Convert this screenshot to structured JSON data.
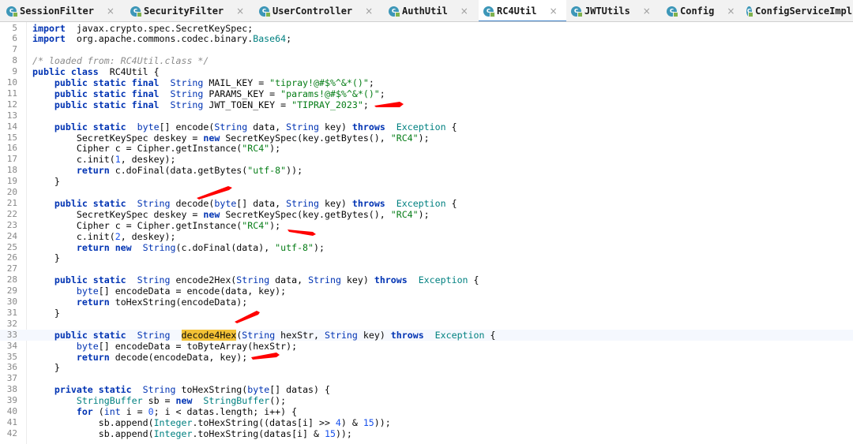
{
  "tabs": [
    {
      "label": "SessionFilter",
      "active": false
    },
    {
      "label": "SecurityFilter",
      "active": false
    },
    {
      "label": "UserController",
      "active": false
    },
    {
      "label": "AuthUtil",
      "active": false
    },
    {
      "label": "RC4Util",
      "active": true
    },
    {
      "label": "JWTUtils",
      "active": false
    },
    {
      "label": "Config",
      "active": false
    },
    {
      "label": "ConfigServiceImpl",
      "active": false
    }
  ],
  "tab_icon_glyph": "c",
  "tab_close_glyph": "×",
  "line_numbers": [
    "5",
    "6",
    "7",
    "8",
    "9",
    "10",
    "11",
    "12",
    "13",
    "14",
    "15",
    "16",
    "17",
    "18",
    "19",
    "20",
    "21",
    "22",
    "23",
    "24",
    "25",
    "26",
    "27",
    "28",
    "29",
    "30",
    "31",
    "32",
    "33",
    "34",
    "35",
    "36",
    "37",
    "38",
    "39",
    "40",
    "41",
    "42"
  ],
  "code_lines": [
    [
      [
        "kw",
        "import"
      ],
      [
        "",
        "  javax.crypto.spec.SecretKeySpec;"
      ]
    ],
    [
      [
        "kw",
        "import"
      ],
      [
        "",
        "  org.apache.commons.codec.binary."
      ],
      [
        "lib",
        "Base64"
      ],
      [
        "",
        ";"
      ]
    ],
    [],
    [
      [
        "cm",
        "/* loaded from: RC4Util.class */"
      ]
    ],
    [
      [
        "kw",
        "public class"
      ],
      [
        "",
        "  RC4Util {"
      ]
    ],
    [
      [
        "",
        "    "
      ],
      [
        "kw",
        "public static final"
      ],
      [
        "",
        "  "
      ],
      [
        "ty",
        "String"
      ],
      [
        "",
        " MAIL_KEY = "
      ],
      [
        "str",
        "\"tipray!@#$%^&*()\""
      ],
      [
        "",
        ";"
      ]
    ],
    [
      [
        "",
        "    "
      ],
      [
        "kw",
        "public static final"
      ],
      [
        "",
        "  "
      ],
      [
        "ty",
        "String"
      ],
      [
        "",
        " PARAMS_KEY = "
      ],
      [
        "str",
        "\"params!@#$%^&*()\""
      ],
      [
        "",
        ";"
      ]
    ],
    [
      [
        "",
        "    "
      ],
      [
        "kw",
        "public static final"
      ],
      [
        "",
        "  "
      ],
      [
        "ty",
        "String"
      ],
      [
        "",
        " JWT_TOEN_KEY = "
      ],
      [
        "str",
        "\"TIPRAY_2023\""
      ],
      [
        "",
        ";"
      ]
    ],
    [],
    [
      [
        "",
        "    "
      ],
      [
        "kw",
        "public static"
      ],
      [
        "",
        "  "
      ],
      [
        "ty",
        "byte"
      ],
      [
        "",
        "[] encode("
      ],
      [
        "ty",
        "String"
      ],
      [
        "",
        " data, "
      ],
      [
        "ty",
        "String"
      ],
      [
        "",
        " key) "
      ],
      [
        "kw",
        "throws"
      ],
      [
        "",
        "  "
      ],
      [
        "lib",
        "Exception"
      ],
      [
        "",
        " {"
      ]
    ],
    [
      [
        "",
        "        SecretKeySpec deskey = "
      ],
      [
        "kw",
        "new"
      ],
      [
        "",
        " SecretKeySpec(key.getBytes(), "
      ],
      [
        "str",
        "\"RC4\""
      ],
      [
        "",
        ");"
      ]
    ],
    [
      [
        "",
        "        Cipher c = Cipher.getInstance("
      ],
      [
        "str",
        "\"RC4\""
      ],
      [
        "",
        ");"
      ]
    ],
    [
      [
        "",
        "        c.init("
      ],
      [
        "num",
        "1"
      ],
      [
        "",
        ", deskey);"
      ]
    ],
    [
      [
        "",
        "        "
      ],
      [
        "kw",
        "return"
      ],
      [
        "",
        " c.doFinal(data.getBytes("
      ],
      [
        "str",
        "\"utf-8\""
      ],
      [
        "",
        "));"
      ]
    ],
    [
      [
        "",
        "    }"
      ]
    ],
    [],
    [
      [
        "",
        "    "
      ],
      [
        "kw",
        "public static"
      ],
      [
        "",
        "  "
      ],
      [
        "ty",
        "String"
      ],
      [
        "",
        " decode("
      ],
      [
        "ty",
        "byte"
      ],
      [
        "",
        "[] data, "
      ],
      [
        "ty",
        "String"
      ],
      [
        "",
        " key) "
      ],
      [
        "kw",
        "throws"
      ],
      [
        "",
        "  "
      ],
      [
        "lib",
        "Exception"
      ],
      [
        "",
        " {"
      ]
    ],
    [
      [
        "",
        "        SecretKeySpec deskey = "
      ],
      [
        "kw",
        "new"
      ],
      [
        "",
        " SecretKeySpec(key.getBytes(), "
      ],
      [
        "str",
        "\"RC4\""
      ],
      [
        "",
        ");"
      ]
    ],
    [
      [
        "",
        "        Cipher c = Cipher.getInstance("
      ],
      [
        "str",
        "\"RC4\""
      ],
      [
        "",
        ");"
      ]
    ],
    [
      [
        "",
        "        c.init("
      ],
      [
        "num",
        "2"
      ],
      [
        "",
        ", deskey);"
      ]
    ],
    [
      [
        "",
        "        "
      ],
      [
        "kw",
        "return new"
      ],
      [
        "",
        "  "
      ],
      [
        "ty",
        "String"
      ],
      [
        "",
        "(c.doFinal(data), "
      ],
      [
        "str",
        "\"utf-8\""
      ],
      [
        "",
        ");"
      ]
    ],
    [
      [
        "",
        "    }"
      ]
    ],
    [],
    [
      [
        "",
        "    "
      ],
      [
        "kw",
        "public static"
      ],
      [
        "",
        "  "
      ],
      [
        "ty",
        "String"
      ],
      [
        "",
        " encode2Hex("
      ],
      [
        "ty",
        "String"
      ],
      [
        "",
        " data, "
      ],
      [
        "ty",
        "String"
      ],
      [
        "",
        " key) "
      ],
      [
        "kw",
        "throws"
      ],
      [
        "",
        "  "
      ],
      [
        "lib",
        "Exception"
      ],
      [
        "",
        " {"
      ]
    ],
    [
      [
        "",
        "        "
      ],
      [
        "ty",
        "byte"
      ],
      [
        "",
        "[] encodeData = encode(data, key);"
      ]
    ],
    [
      [
        "",
        "        "
      ],
      [
        "kw",
        "return"
      ],
      [
        "",
        " toHexString(encodeData);"
      ]
    ],
    [
      [
        "",
        "    }"
      ]
    ],
    [],
    [
      [
        "",
        "    "
      ],
      [
        "kw",
        "public static"
      ],
      [
        "",
        "  "
      ],
      [
        "ty",
        "String"
      ],
      [
        "",
        "  "
      ],
      [
        "hl",
        "decode4Hex"
      ],
      [
        "",
        "("
      ],
      [
        "ty",
        "String"
      ],
      [
        "",
        " hexStr, "
      ],
      [
        "ty",
        "String"
      ],
      [
        "",
        " key) "
      ],
      [
        "kw",
        "throws"
      ],
      [
        "",
        "  "
      ],
      [
        "lib",
        "Exception"
      ],
      [
        "",
        " {"
      ]
    ],
    [
      [
        "",
        "        "
      ],
      [
        "ty",
        "byte"
      ],
      [
        "",
        "[] encodeData = toByteArray(hexStr);"
      ]
    ],
    [
      [
        "",
        "        "
      ],
      [
        "kw",
        "return"
      ],
      [
        "",
        " decode(encodeData, key);"
      ]
    ],
    [
      [
        "",
        "    }"
      ]
    ],
    [],
    [
      [
        "",
        "    "
      ],
      [
        "kw",
        "private static"
      ],
      [
        "",
        "  "
      ],
      [
        "ty",
        "String"
      ],
      [
        "",
        " toHexString("
      ],
      [
        "ty",
        "byte"
      ],
      [
        "",
        "[] datas) {"
      ]
    ],
    [
      [
        "",
        "        "
      ],
      [
        "lib",
        "StringBuffer"
      ],
      [
        "",
        " sb = "
      ],
      [
        "kw",
        "new"
      ],
      [
        "",
        "  "
      ],
      [
        "lib",
        "StringBuffer"
      ],
      [
        "",
        "();"
      ]
    ],
    [
      [
        "",
        "        "
      ],
      [
        "kw",
        "for"
      ],
      [
        "",
        " ("
      ],
      [
        "ty",
        "int"
      ],
      [
        "",
        " i = "
      ],
      [
        "num",
        "0"
      ],
      [
        "",
        "; i < datas.length; i++) {"
      ]
    ],
    [
      [
        "",
        "            sb.append("
      ],
      [
        "lib",
        "Integer"
      ],
      [
        "",
        ".toHexString((datas[i] >> "
      ],
      [
        "num",
        "4"
      ],
      [
        "",
        ") & "
      ],
      [
        "num",
        "15"
      ],
      [
        "",
        "));"
      ]
    ],
    [
      [
        "",
        "            sb.append("
      ],
      [
        "lib",
        "Integer"
      ],
      [
        "",
        ".toHexString(datas[i] & "
      ],
      [
        "num",
        "15"
      ],
      [
        "",
        "));"
      ]
    ]
  ],
  "highlighted_line": "33",
  "annotation_color": "#ff0000"
}
